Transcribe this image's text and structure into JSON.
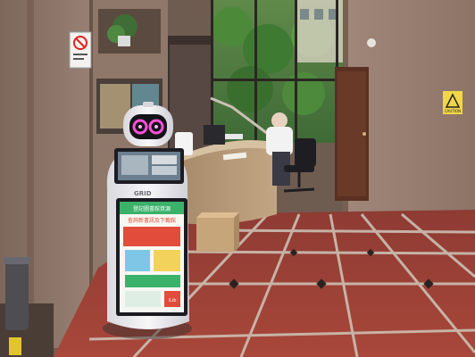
{
  "scene": {
    "robot_brand": "GRID",
    "robot_screen_headline_1": "登記圖書館資源",
    "robot_screen_headline_2": "查詢新書訊及下載館",
    "robot_screen_footer_badge": "iLib",
    "sign_caution": "CAUTION",
    "no_smoking_label": "禁止吸煙"
  },
  "colors": {
    "floor_red": "#9c3d33",
    "floor_line": "#c9c3b8",
    "marble": "#8a7568",
    "robot_body": "#f1f1f3",
    "robot_eye": "#ff4fd8",
    "screen_green": "#3bb26a",
    "screen_red": "#e24c3b",
    "desk_marble": "#b59a7a"
  },
  "icons": [
    "robot-icon",
    "no-smoking-sign-icon",
    "caution-sign-icon",
    "trash-bin-icon"
  ]
}
